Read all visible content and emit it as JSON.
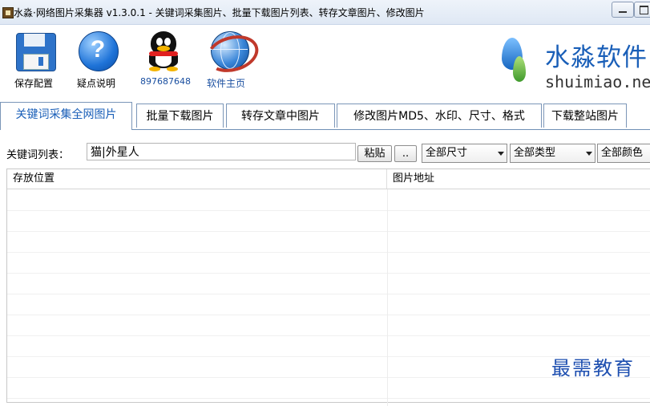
{
  "window": {
    "title": "水淼·网络图片采集器 v1.3.0.1 - 关键词采集图片、批量下载图片列表、转存文章图片、修改图片"
  },
  "toolbar": {
    "items": [
      {
        "label": "保存配置",
        "icon": "save-icon"
      },
      {
        "label": "疑点说明",
        "icon": "help-icon"
      },
      {
        "label": "897687648",
        "icon": "qq-icon"
      },
      {
        "label": "软件主页",
        "icon": "globe-icon"
      }
    ]
  },
  "logo": {
    "text_cn": "水淼软件",
    "text_en": "shuimiao.ne"
  },
  "tabs": [
    {
      "label": "关键词采集全网图片",
      "active": true
    },
    {
      "label": "批量下载图片",
      "active": false
    },
    {
      "label": "转存文章中图片",
      "active": false
    },
    {
      "label": "修改图片MD5、水印、尺寸、格式",
      "active": false
    },
    {
      "label": "下载整站图片",
      "active": false
    }
  ],
  "controls": {
    "keyword_label": "关键词列表：",
    "keyword_value": "猫|外星人",
    "paste_button": "粘贴",
    "browse_button": "..",
    "size_select": "全部尺寸",
    "type_select": "全部类型",
    "color_select": "全部颜色"
  },
  "table": {
    "columns": [
      "存放位置",
      "图片地址"
    ],
    "rows": []
  },
  "watermark": "最需教育"
}
